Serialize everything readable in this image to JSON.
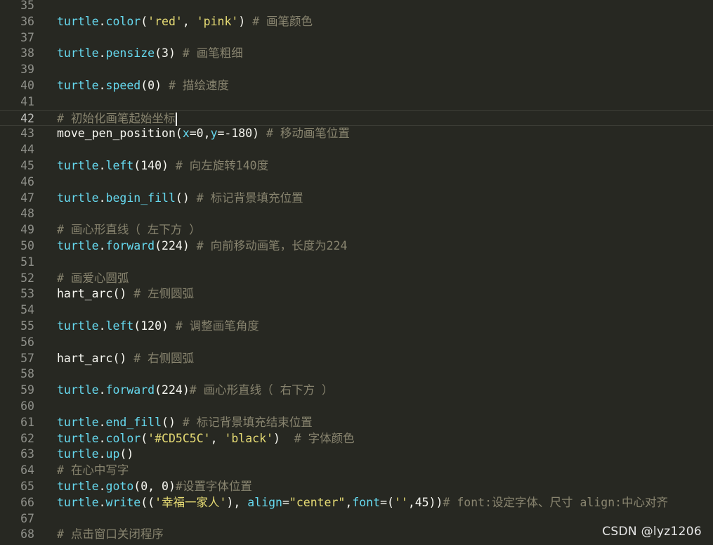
{
  "editor": {
    "active_line": 42,
    "lines": [
      {
        "n": "35",
        "tokens": []
      },
      {
        "n": "36",
        "tokens": [
          [
            "obj",
            "turtle"
          ],
          [
            "plain",
            "."
          ],
          [
            "obj",
            "color"
          ],
          [
            "plain",
            "("
          ],
          [
            "str",
            "'red'"
          ],
          [
            "plain",
            ", "
          ],
          [
            "str",
            "'pink'"
          ],
          [
            "plain",
            ") "
          ],
          [
            "cmt",
            "# 画笔颜色"
          ]
        ]
      },
      {
        "n": "37",
        "tokens": []
      },
      {
        "n": "38",
        "tokens": [
          [
            "obj",
            "turtle"
          ],
          [
            "plain",
            "."
          ],
          [
            "obj",
            "pensize"
          ],
          [
            "plain",
            "(3) "
          ],
          [
            "cmt",
            "# 画笔粗细"
          ]
        ]
      },
      {
        "n": "39",
        "tokens": []
      },
      {
        "n": "40",
        "tokens": [
          [
            "obj",
            "turtle"
          ],
          [
            "plain",
            "."
          ],
          [
            "obj",
            "speed"
          ],
          [
            "plain",
            "(0) "
          ],
          [
            "cmt",
            "# 描绘速度"
          ]
        ]
      },
      {
        "n": "41",
        "tokens": []
      },
      {
        "n": "42",
        "tokens": [
          [
            "cmt",
            "# 初始化画笔起始坐标"
          ]
        ]
      },
      {
        "n": "43",
        "tokens": [
          [
            "plain",
            "move_pen_position("
          ],
          [
            "kw",
            "x"
          ],
          [
            "plain",
            "=0,"
          ],
          [
            "kw",
            "y"
          ],
          [
            "plain",
            "=-180) "
          ],
          [
            "cmt",
            "# 移动画笔位置"
          ]
        ]
      },
      {
        "n": "44",
        "tokens": []
      },
      {
        "n": "45",
        "tokens": [
          [
            "obj",
            "turtle"
          ],
          [
            "plain",
            "."
          ],
          [
            "obj",
            "left"
          ],
          [
            "plain",
            "(140) "
          ],
          [
            "cmt",
            "# 向左旋转140度"
          ]
        ]
      },
      {
        "n": "46",
        "tokens": []
      },
      {
        "n": "47",
        "tokens": [
          [
            "obj",
            "turtle"
          ],
          [
            "plain",
            "."
          ],
          [
            "obj",
            "begin_fill"
          ],
          [
            "plain",
            "() "
          ],
          [
            "cmt",
            "# 标记背景填充位置"
          ]
        ]
      },
      {
        "n": "48",
        "tokens": []
      },
      {
        "n": "49",
        "tokens": [
          [
            "cmt",
            "# 画心形直线（ 左下方 ）"
          ]
        ]
      },
      {
        "n": "50",
        "tokens": [
          [
            "obj",
            "turtle"
          ],
          [
            "plain",
            "."
          ],
          [
            "obj",
            "forward"
          ],
          [
            "plain",
            "(224) "
          ],
          [
            "cmt",
            "# 向前移动画笔，长度为224"
          ]
        ]
      },
      {
        "n": "51",
        "tokens": []
      },
      {
        "n": "52",
        "tokens": [
          [
            "cmt",
            "# 画爱心圆弧"
          ]
        ]
      },
      {
        "n": "53",
        "tokens": [
          [
            "plain",
            "hart_arc() "
          ],
          [
            "cmt",
            "# 左侧圆弧"
          ]
        ]
      },
      {
        "n": "54",
        "tokens": []
      },
      {
        "n": "55",
        "tokens": [
          [
            "obj",
            "turtle"
          ],
          [
            "plain",
            "."
          ],
          [
            "obj",
            "left"
          ],
          [
            "plain",
            "(120) "
          ],
          [
            "cmt",
            "# 调整画笔角度"
          ]
        ]
      },
      {
        "n": "56",
        "tokens": []
      },
      {
        "n": "57",
        "tokens": [
          [
            "plain",
            "hart_arc() "
          ],
          [
            "cmt",
            "# 右侧圆弧"
          ]
        ]
      },
      {
        "n": "58",
        "tokens": []
      },
      {
        "n": "59",
        "tokens": [
          [
            "obj",
            "turtle"
          ],
          [
            "plain",
            "."
          ],
          [
            "obj",
            "forward"
          ],
          [
            "plain",
            "(224)"
          ],
          [
            "cmt",
            "# 画心形直线（ 右下方 ）"
          ]
        ]
      },
      {
        "n": "60",
        "tokens": []
      },
      {
        "n": "61",
        "tokens": [
          [
            "obj",
            "turtle"
          ],
          [
            "plain",
            "."
          ],
          [
            "obj",
            "end_fill"
          ],
          [
            "plain",
            "() "
          ],
          [
            "cmt",
            "# 标记背景填充结束位置"
          ]
        ]
      },
      {
        "n": "62",
        "tokens": [
          [
            "obj",
            "turtle"
          ],
          [
            "plain",
            "."
          ],
          [
            "obj",
            "color"
          ],
          [
            "plain",
            "("
          ],
          [
            "str",
            "'#CD5C5C'"
          ],
          [
            "plain",
            ", "
          ],
          [
            "str",
            "'black'"
          ],
          [
            "plain",
            ")  "
          ],
          [
            "cmt",
            "# 字体颜色"
          ]
        ]
      },
      {
        "n": "63",
        "tokens": [
          [
            "obj",
            "turtle"
          ],
          [
            "plain",
            "."
          ],
          [
            "obj",
            "up"
          ],
          [
            "plain",
            "()"
          ]
        ]
      },
      {
        "n": "64",
        "tokens": [
          [
            "cmt",
            "# 在心中写字"
          ]
        ]
      },
      {
        "n": "65",
        "tokens": [
          [
            "obj",
            "turtle"
          ],
          [
            "plain",
            "."
          ],
          [
            "obj",
            "goto"
          ],
          [
            "plain",
            "(0, 0)"
          ],
          [
            "cmt",
            "#设置字体位置"
          ]
        ]
      },
      {
        "n": "66",
        "tokens": [
          [
            "obj",
            "turtle"
          ],
          [
            "plain",
            "."
          ],
          [
            "obj",
            "write"
          ],
          [
            "plain",
            "(("
          ],
          [
            "str",
            "'幸福一家人'"
          ],
          [
            "plain",
            "), "
          ],
          [
            "kw",
            "align"
          ],
          [
            "plain",
            "="
          ],
          [
            "str",
            "\"center\""
          ],
          [
            "plain",
            ","
          ],
          [
            "kw",
            "font"
          ],
          [
            "plain",
            "=("
          ],
          [
            "str",
            "''"
          ],
          [
            "plain",
            ",45))"
          ],
          [
            "cmt",
            "# font:设定字体、尺寸 align:中心对齐"
          ]
        ]
      },
      {
        "n": "67",
        "tokens": []
      },
      {
        "n": "68",
        "tokens": [
          [
            "cmt",
            "# 点击窗口关闭程序"
          ]
        ]
      }
    ]
  },
  "watermark": "CSDN @lyz1206"
}
